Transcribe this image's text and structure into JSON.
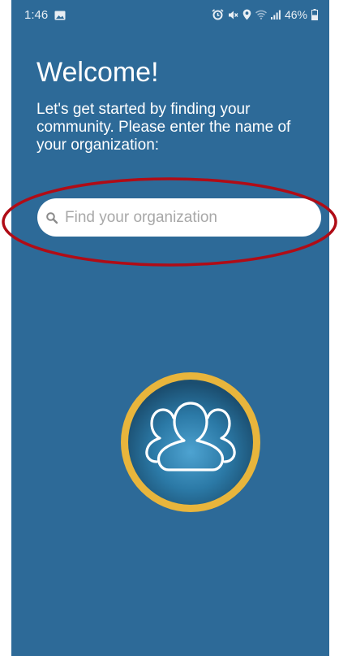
{
  "status_bar": {
    "time": "1:46",
    "battery": "46%",
    "icons": [
      "image-icon",
      "alarm-icon",
      "mute-icon",
      "location-icon",
      "wifi-icon",
      "signal-icon",
      "battery-icon"
    ]
  },
  "welcome": {
    "title": "Welcome!",
    "text": "Let's get started by finding your community. Please enter the name of your organization:"
  },
  "search": {
    "placeholder": "Find your organization",
    "value": ""
  },
  "colors": {
    "background": "#2d6a98",
    "highlight": "#b00c16",
    "logo_ring": "#e8b53c"
  }
}
